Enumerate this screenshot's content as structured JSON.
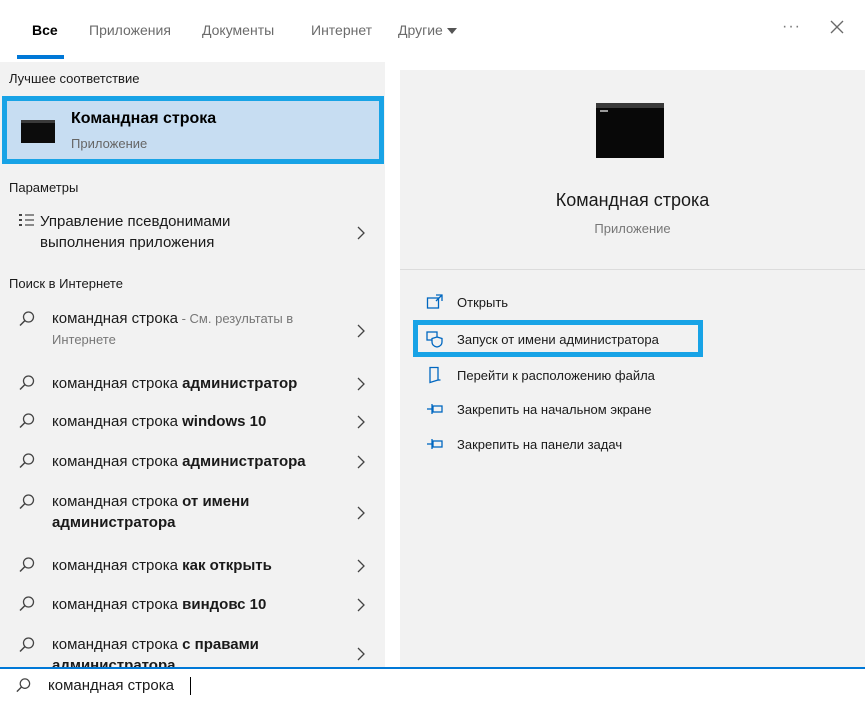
{
  "tabs": {
    "all": "Все",
    "apps": "Приложения",
    "docs": "Документы",
    "web": "Интернет",
    "other": "Другие"
  },
  "toolbar": {
    "more": "···"
  },
  "left": {
    "best_match_header": "Лучшее соответствие",
    "best_match": {
      "title": "Командная строка",
      "subtitle": "Приложение"
    },
    "settings_header": "Параметры",
    "settings_item": {
      "line1": "Управление псевдонимами",
      "line2": "выполнения приложения"
    },
    "web_header": "Поиск в Интернете",
    "web_results": [
      {
        "prefix": "командная строка",
        "bold": "",
        "suffix_dim": " - См. результаты в",
        "line2_dim": "Интернете"
      },
      {
        "prefix": "командная строка ",
        "bold": "администратор"
      },
      {
        "prefix": "командная строка ",
        "bold": "windows 10"
      },
      {
        "prefix": "командная строка ",
        "bold": "администратора"
      },
      {
        "prefix": "командная строка ",
        "bold": "от имени",
        "line2_bold": "администратора"
      },
      {
        "prefix": "командная строка ",
        "bold": "как открыть"
      },
      {
        "prefix": "командная строка ",
        "bold": "виндовс 10"
      },
      {
        "prefix": "командная строка ",
        "bold": "с правами",
        "line2_bold": "администратора"
      }
    ]
  },
  "detail": {
    "title": "Командная строка",
    "subtitle": "Приложение",
    "actions": [
      {
        "label": "Открыть",
        "icon": "open-icon"
      },
      {
        "label": "Запуск от имени администратора",
        "icon": "shield-icon"
      },
      {
        "label": "Перейти к расположению файла",
        "icon": "file-location-icon"
      },
      {
        "label": "Закрепить на начальном экране",
        "icon": "pin-icon"
      },
      {
        "label": "Закрепить на панели задач",
        "icon": "pin-icon"
      }
    ]
  },
  "search": {
    "value": "командная строка"
  },
  "colors": {
    "accent": "#0078d7",
    "highlight": "#18a3e6",
    "selected_bg": "#c7ddf2",
    "panel_bg": "#f2f2f2"
  }
}
